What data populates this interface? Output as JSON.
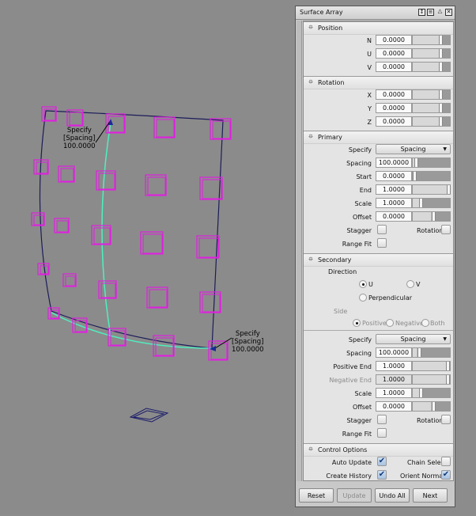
{
  "viewport": {
    "annotations": [
      {
        "lines": [
          "Specify",
          "[Spacing]",
          "100.0000"
        ]
      },
      {
        "lines": [
          "Specify",
          "[Spacing]",
          "100.0000"
        ]
      }
    ]
  },
  "panel": {
    "title": "Surface Array",
    "position": {
      "header": "Position",
      "fields": [
        {
          "label": "N",
          "value": "0.0000"
        },
        {
          "label": "U",
          "value": "0.0000"
        },
        {
          "label": "V",
          "value": "0.0000"
        }
      ]
    },
    "rotation": {
      "header": "Rotation",
      "fields": [
        {
          "label": "X",
          "value": "0.0000"
        },
        {
          "label": "Y",
          "value": "0.0000"
        },
        {
          "label": "Z",
          "value": "0.0000"
        }
      ]
    },
    "primary": {
      "header": "Primary",
      "specify_label": "Specify",
      "specify_value": "Spacing",
      "fields": [
        {
          "label": "Spacing",
          "value": "100.0000"
        },
        {
          "label": "Start",
          "value": "0.0000"
        },
        {
          "label": "End",
          "value": "1.0000"
        },
        {
          "label": "Scale",
          "value": "1.0000"
        },
        {
          "label": "Offset",
          "value": "0.0000"
        }
      ],
      "stagger": "Stagger",
      "rotation": "Rotation",
      "range_fit": "Range Fit"
    },
    "secondary": {
      "header": "Secondary",
      "direction": "Direction",
      "dir_u": "U",
      "dir_v": "V",
      "dir_perp": "Perpendicular",
      "side": "Side",
      "side_pos": "Positive",
      "side_neg": "Negative",
      "side_both": "Both",
      "specify_label": "Specify",
      "specify_value": "Spacing",
      "fields": [
        {
          "label": "Spacing",
          "value": "100.0000"
        },
        {
          "label": "Positive End",
          "value": "1.0000"
        },
        {
          "label": "Negative End",
          "value": "1.0000"
        },
        {
          "label": "Scale",
          "value": "1.0000"
        },
        {
          "label": "Offset",
          "value": "0.0000"
        }
      ],
      "stagger": "Stagger",
      "rotation": "Rotation",
      "range_fit": "Range Fit"
    },
    "control": {
      "header": "Control Options",
      "auto_update": "Auto Update",
      "chain_select": "Chain Select",
      "create_history": "Create History",
      "orient_normals": "Orient Normals"
    },
    "buttons": {
      "reset": "Reset",
      "update": "Update",
      "undo_all": "Undo All",
      "next": "Next"
    }
  }
}
